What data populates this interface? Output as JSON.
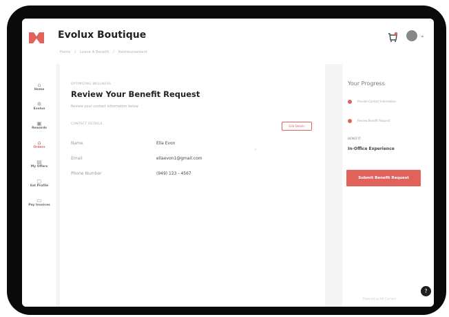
{
  "header": {
    "brand": "Evolux Boutique",
    "breadcrumbs": [
      "Home",
      "Leave A Benefit",
      "Reimbursement"
    ],
    "cart_icon": "cart-icon",
    "avatar_icon": "avatar",
    "chevron": "⌄"
  },
  "sidebar": {
    "items": [
      {
        "icon": "⌂",
        "label": "Home"
      },
      {
        "icon": "✲",
        "label": "Evolux"
      },
      {
        "icon": "▣",
        "label": "Rewards"
      },
      {
        "icon": "⌂",
        "label": "Orders",
        "active": true
      },
      {
        "icon": "▤",
        "label": "My Offers"
      },
      {
        "icon": "◻",
        "label": "Eat Profile"
      },
      {
        "icon": "▭",
        "label": "Pay Invoices"
      }
    ]
  },
  "main": {
    "section_tag": "OPTIMIZING WELLNESS",
    "title": "Review Your Benefit Request",
    "subtitle": "Review your contact information below",
    "contact_label": "CONTACT DETAILS",
    "edit_label": "Edit Details",
    "fields": [
      {
        "label": "Name",
        "value": "Ella Evon"
      },
      {
        "label": "Email",
        "value": "ellaevon1@gmail.com"
      },
      {
        "label": "Phone Number",
        "value": "(949) 123 - 4567"
      }
    ],
    "eye_icon": "◦"
  },
  "progress": {
    "title": "Your Progress",
    "steps": [
      "Provide Contact Information",
      "Review Benefit Request"
    ],
    "benefit_label": "BENEFIT",
    "benefit_value": "In-Office Experience",
    "submit_label": "Submit Benefit Request",
    "footnote": "Powered by HR Connect"
  },
  "help_label": "?",
  "colors": {
    "accent": "#e0625a",
    "bezel": "#0a0a0a",
    "screen_bg": "#f4f4f4"
  }
}
